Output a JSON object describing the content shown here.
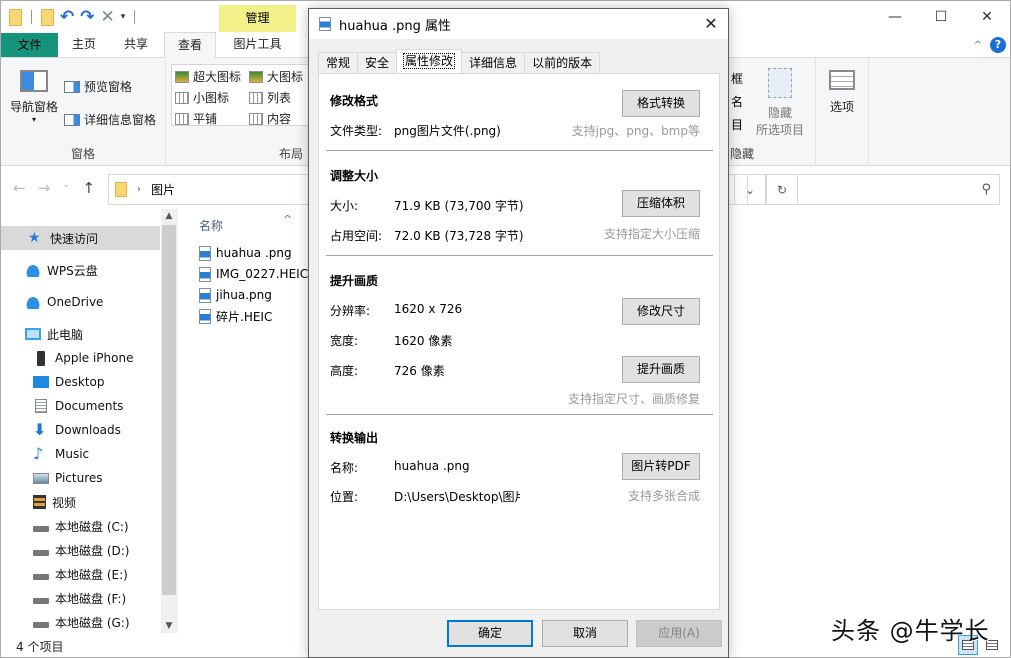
{
  "explorer": {
    "qat": {
      "undo": "↶",
      "redo": "↷",
      "delete": "✕",
      "dropdown": "▾"
    },
    "context_tab_group": "管理",
    "window_controls": {
      "minimize": "—",
      "maximize": "☐",
      "close": "✕"
    },
    "ribbon_tabs": [
      {
        "label": "文件"
      },
      {
        "label": "主页"
      },
      {
        "label": "共享"
      },
      {
        "label": "查看",
        "active": true
      },
      {
        "label": "图片工具"
      }
    ],
    "help": "?",
    "collapse_ribbon": "^",
    "ribbon": {
      "panes": {
        "label": "窗格",
        "nav_pane": "导航窗格",
        "nav_pane_dropdown": "▾",
        "preview_pane": "预览窗格",
        "details_pane": "详细信息窗格"
      },
      "layout": {
        "label": "布局",
        "items": [
          "超大图标",
          "大图标",
          "小图标",
          "列表",
          "平铺",
          "内容"
        ]
      },
      "show_hide": {
        "label": "隐藏",
        "partial": [
          "框",
          "名",
          "目"
        ],
        "hide_selected": [
          "隐藏",
          "所选项目"
        ]
      },
      "options": "选项"
    },
    "address": {
      "back": "←",
      "forward": "→",
      "recent": "⌄",
      "up": "↑",
      "separator": "›",
      "path": "图片",
      "dropdown": "⌄",
      "refresh": "↻",
      "search_icon": "⚲",
      "search_placeholder": ""
    },
    "nav_pane": {
      "items": [
        {
          "label": "快速访问",
          "icon": "star",
          "selected": true
        },
        {
          "label": "WPS云盘",
          "icon": "cloud"
        },
        {
          "label": "OneDrive",
          "icon": "cloud"
        },
        {
          "label": "此电脑",
          "icon": "pc"
        },
        {
          "label": "Apple iPhone",
          "icon": "phone"
        },
        {
          "label": "Desktop",
          "icon": "desk"
        },
        {
          "label": "Documents",
          "icon": "doc"
        },
        {
          "label": "Downloads",
          "icon": "down"
        },
        {
          "label": "Music",
          "icon": "music"
        },
        {
          "label": "Pictures",
          "icon": "pic"
        },
        {
          "label": "视频",
          "icon": "video"
        },
        {
          "label": "本地磁盘 (C:)",
          "icon": "drive"
        },
        {
          "label": "本地磁盘 (D:)",
          "icon": "drive"
        },
        {
          "label": "本地磁盘 (E:)",
          "icon": "drive"
        },
        {
          "label": "本地磁盘 (F:)",
          "icon": "drive"
        },
        {
          "label": "本地磁盘 (G:)",
          "icon": "drive"
        }
      ],
      "scroll_up": "▲",
      "scroll_down": "▼"
    },
    "file_list": {
      "column_header": "名称",
      "sort_indicator": "^",
      "files": [
        "huahua .png",
        "IMG_0227.HEIC",
        "jihua.png",
        "碎片.HEIC"
      ]
    },
    "status": {
      "item_count": "4 个项目"
    },
    "watermark": "头条 @牛学长"
  },
  "dialog": {
    "title": "huahua .png 属性",
    "close": "✕",
    "tabs": [
      {
        "label": "常规"
      },
      {
        "label": "安全"
      },
      {
        "label": "属性修改",
        "active": true
      },
      {
        "label": "详细信息"
      },
      {
        "label": "以前的版本"
      }
    ],
    "sections": {
      "format": {
        "title": "修改格式",
        "button": "格式转换",
        "file_type_label": "文件类型:",
        "file_type_value": "png图片文件(.png)",
        "hint": "支持jpg、png、bmp等"
      },
      "resize": {
        "title": "调整大小",
        "size_label": "大小:",
        "size_value": "71.9 KB (73,700 字节)",
        "button": "压缩体积",
        "disk_label": "占用空间:",
        "disk_value": "72.0 KB (73,728 字节)",
        "hint": "支持指定大小压缩"
      },
      "quality": {
        "title": "提升画质",
        "resolution_label": "分辨率:",
        "resolution_value": "1620 x 726",
        "resize_button": "修改尺寸",
        "width_label": "宽度:",
        "width_value": "1620 像素",
        "height_label": "高度:",
        "height_value": "726 像素",
        "enhance_button": "提升画质",
        "hint": "支持指定尺寸、画质修复"
      },
      "convert": {
        "title": "转换输出",
        "name_label": "名称:",
        "name_value": "huahua .png",
        "button": "图片转PDF",
        "location_label": "位置:",
        "location_value": "D:\\Users\\Desktop\\图片",
        "hint": "支持多张合成"
      }
    },
    "buttons": {
      "ok": "确定",
      "cancel": "取消",
      "apply": "应用(A)"
    }
  }
}
